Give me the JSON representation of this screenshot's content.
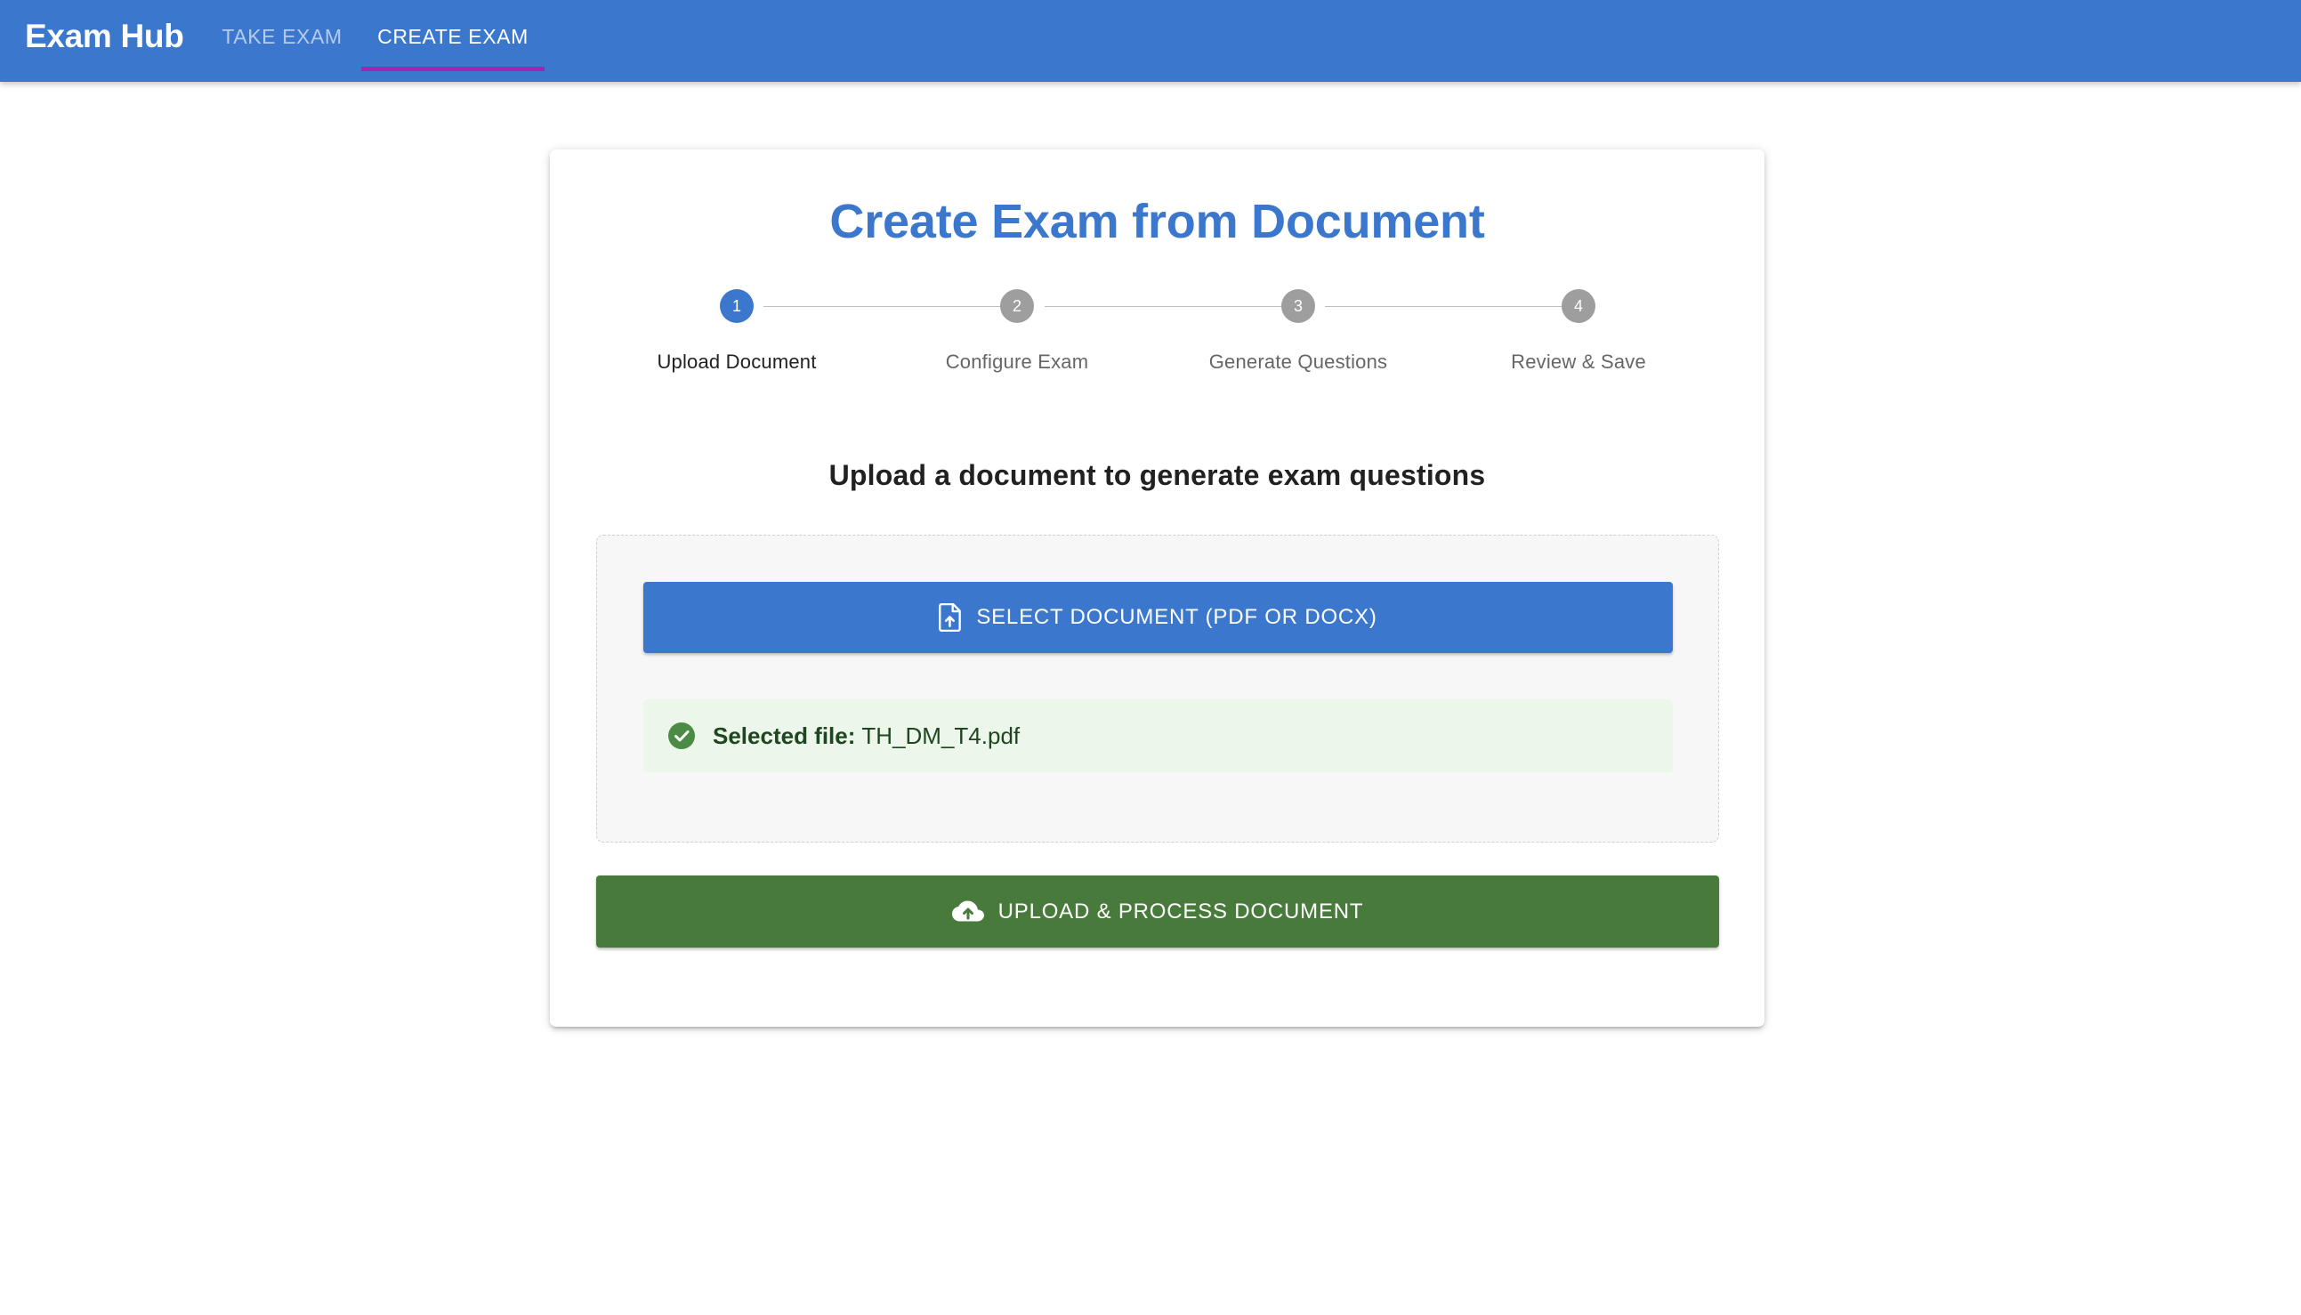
{
  "appbar": {
    "brand": "Exam Hub",
    "tabs": [
      {
        "label": "TAKE EXAM",
        "active": false
      },
      {
        "label": "CREATE EXAM",
        "active": true
      }
    ],
    "colors": {
      "background": "#3a77cd",
      "indicator": "#9c27b0"
    }
  },
  "card": {
    "title": "Create Exam from Document",
    "stepper": {
      "active_step": 1,
      "steps": [
        {
          "number": "1",
          "label": "Upload Document"
        },
        {
          "number": "2",
          "label": "Configure Exam"
        },
        {
          "number": "3",
          "label": "Generate Questions"
        },
        {
          "number": "4",
          "label": "Review & Save"
        }
      ]
    },
    "upload": {
      "prompt": "Upload a document to generate exam questions",
      "select_button": {
        "label": "SELECT DOCUMENT (PDF OR DOCX)",
        "icon": "upload-file-icon"
      },
      "selected_file": {
        "label": "Selected file:",
        "filename": "TH_DM_T4.pdf",
        "icon": "check-circle-icon"
      },
      "process_button": {
        "label": "UPLOAD & PROCESS DOCUMENT",
        "icon": "cloud-upload-icon"
      }
    },
    "colors": {
      "primary": "#3a77cd",
      "success": "#487b3b",
      "success_bg": "#edf6ea",
      "inactive_step": "#9e9e9e"
    }
  }
}
